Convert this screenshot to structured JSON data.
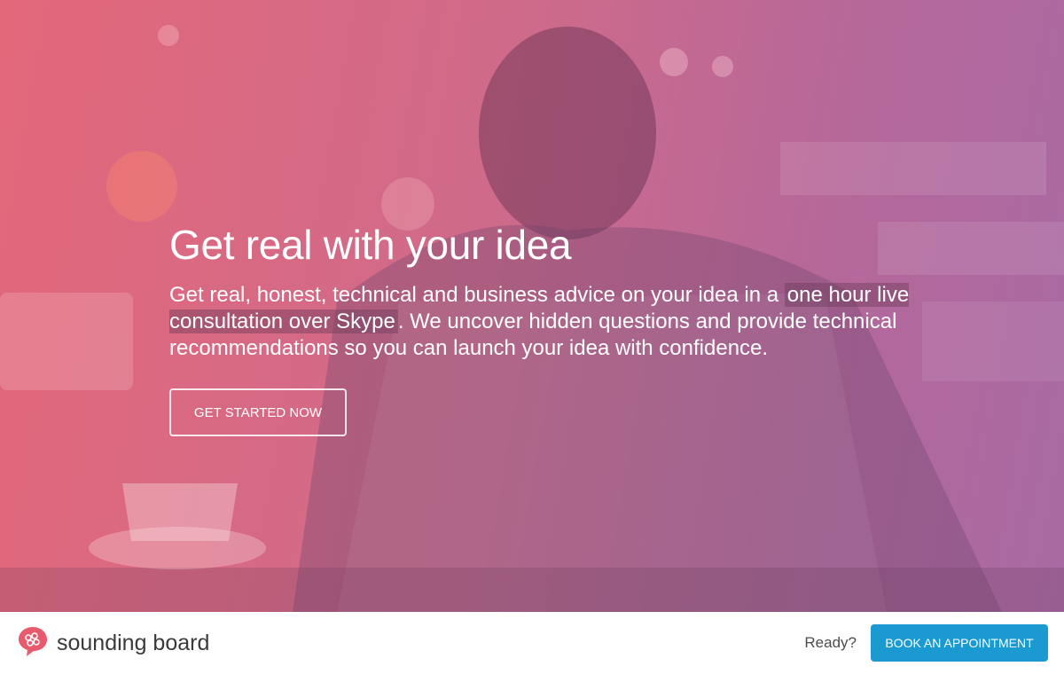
{
  "hero": {
    "title": "Get real with your idea",
    "body_part1": "Get real, honest, technical and business advice on your idea in a ",
    "body_highlight": "one hour live consultation over Skype",
    "body_part2": ". We uncover hidden questions and provide technical recommendations so you can launch your idea with confidence.",
    "cta_label": "GET STARTED NOW",
    "overlay_colors": [
      "#e3687a",
      "#cf6a8a",
      "#a86aa3"
    ]
  },
  "footer": {
    "brand_name": "sounding board",
    "logo_icon": "speech-bubble-logo-icon",
    "ready_text": "Ready?",
    "book_label": "BOOK AN APPOINTMENT",
    "book_color": "#1a9ad1",
    "logo_color": "#e85a6e"
  }
}
